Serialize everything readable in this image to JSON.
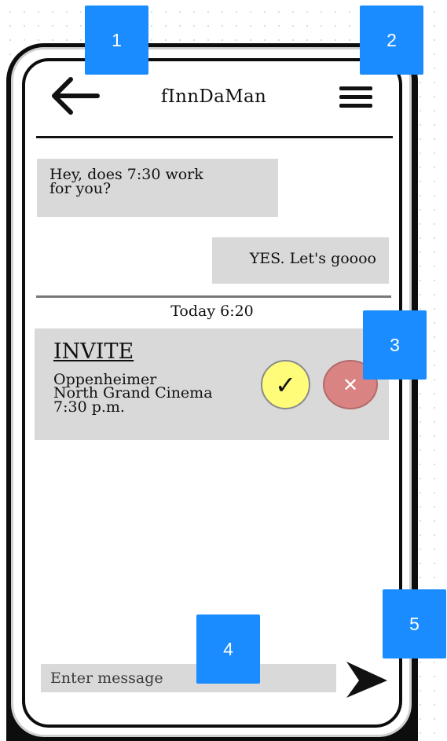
{
  "header": {
    "title": "fInnDaMan",
    "back_icon": "arrow-left-icon",
    "menu_icon": "hamburger-menu-icon"
  },
  "messages": [
    {
      "direction": "incoming",
      "lines": [
        "Hey, does 7:30 work",
        "for you?"
      ]
    },
    {
      "direction": "outgoing",
      "text": "YES. Let's goooo"
    }
  ],
  "timestamp": "Today 6:20",
  "invite": {
    "title": "INVITE",
    "movie": "Oppenheimer",
    "venue": "North Grand Cinema",
    "time": "7:30 p.m.",
    "accept_symbol": "✓",
    "decline_symbol": "✕",
    "accept_color": "#fffc7a",
    "decline_color": "#d98383"
  },
  "composer": {
    "placeholder": "Enter message",
    "send_icon": "send-arrow-icon"
  },
  "annotations": {
    "marker_color": "#1a8cff",
    "labels": [
      "1",
      "2",
      "3",
      "4",
      "5"
    ]
  }
}
